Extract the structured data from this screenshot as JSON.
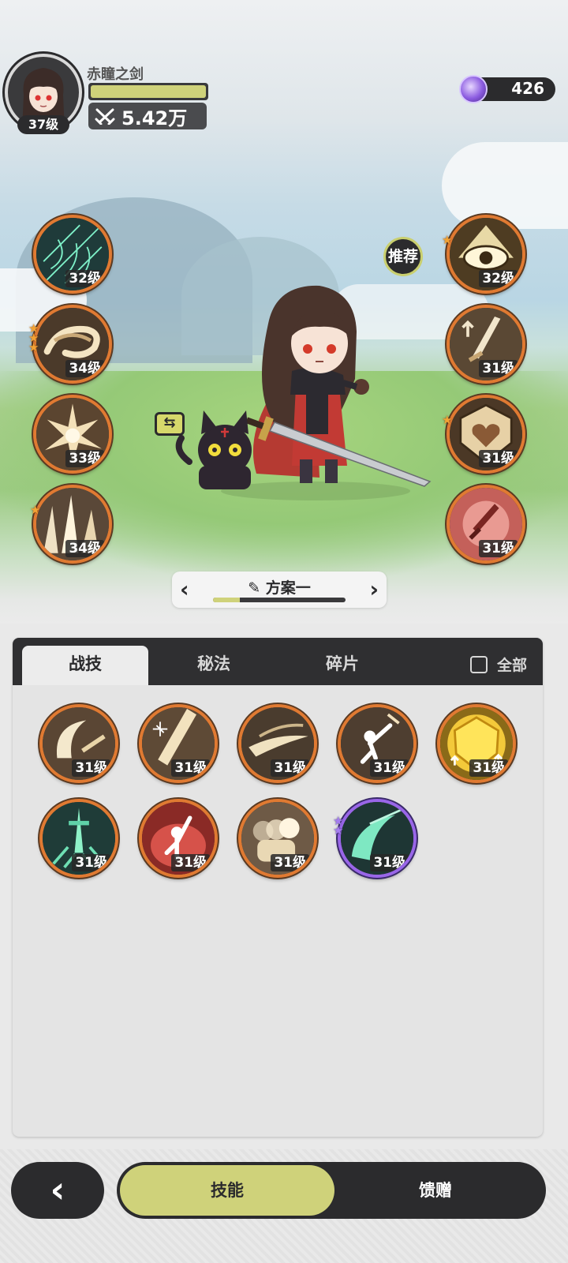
{
  "player": {
    "name": "赤瞳之剑",
    "level": "37级",
    "power": "5.42万",
    "hp_percent": 100
  },
  "currency": {
    "icon": "crystal-gem-icon",
    "amount": "426"
  },
  "recommend_label": "推荐",
  "equipped_left": [
    {
      "icon": "web-net-icon",
      "level": "32级",
      "stars": 0
    },
    {
      "icon": "whirlwind-icon",
      "level": "34级",
      "stars": 3
    },
    {
      "icon": "burst-explosion-icon",
      "level": "33级",
      "stars": 0
    },
    {
      "icon": "spike-ground-icon",
      "level": "34级",
      "stars": 1
    }
  ],
  "equipped_right": [
    {
      "icon": "eye-icon",
      "level": "32级",
      "stars": 1
    },
    {
      "icon": "sword-up-icon",
      "level": "31级",
      "stars": 0
    },
    {
      "icon": "heart-shield-icon",
      "level": "31级",
      "stars": 1
    },
    {
      "icon": "red-sword-icon",
      "level": "31级",
      "stars": 0
    }
  ],
  "loadout": {
    "name": "方案一",
    "progress": 0.2
  },
  "tabs": [
    {
      "label": "战技",
      "active": true
    },
    {
      "label": "秘法",
      "active": false
    },
    {
      "label": "碎片",
      "active": false
    }
  ],
  "filter_all_label": "全部",
  "skills": [
    {
      "icon": "crescent-slash-icon",
      "level": "31级",
      "rarity": "orange"
    },
    {
      "icon": "greatsword-strike-icon",
      "level": "31级",
      "rarity": "orange"
    },
    {
      "icon": "wind-slash-icon",
      "level": "31级",
      "rarity": "orange"
    },
    {
      "icon": "leap-attack-icon",
      "level": "31级",
      "rarity": "orange"
    },
    {
      "icon": "golden-shield-icon",
      "level": "31级",
      "rarity": "orange"
    },
    {
      "icon": "emerald-sword-icon",
      "level": "31级",
      "rarity": "orange"
    },
    {
      "icon": "rage-aura-icon",
      "level": "31级",
      "rarity": "orange"
    },
    {
      "icon": "afterimage-dash-icon",
      "level": "31级",
      "rarity": "orange"
    },
    {
      "icon": "jade-crescent-icon",
      "level": "31级",
      "rarity": "purple",
      "stars": 2
    }
  ],
  "bottom": {
    "back_icon": "back-arrow-icon",
    "skills_label": "技能",
    "gift_label": "馈赠"
  }
}
